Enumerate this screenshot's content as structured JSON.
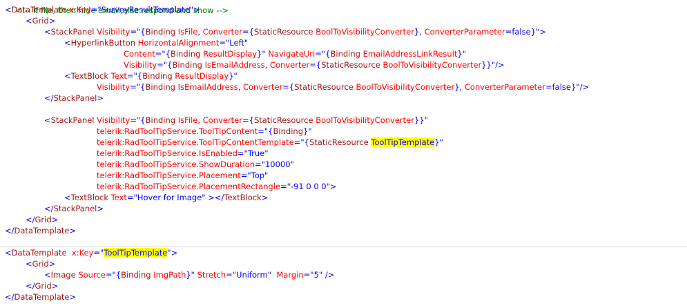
{
  "code": {
    "comment_fragment": "<!-- If file, then hide email,else respond and show -->",
    "lines": [
      {
        "indent": 0,
        "tokens": [
          [
            "p",
            "<"
          ],
          [
            "k",
            "DataTemplate"
          ],
          [
            "a",
            " x:Key"
          ],
          [
            "v",
            "=\"SurveyResultTemplate\""
          ],
          [
            "p",
            ">"
          ]
        ]
      },
      {
        "indent": 1,
        "tokens": [
          [
            "p",
            "<"
          ],
          [
            "k",
            "Grid"
          ],
          [
            "p",
            ">"
          ]
        ]
      },
      {
        "indent": 2,
        "tokens": [
          [
            "p",
            "<"
          ],
          [
            "k",
            "StackPanel"
          ],
          [
            "a",
            " Visibility"
          ],
          [
            "v",
            "=\"{"
          ],
          [
            "k",
            "Binding"
          ],
          [
            "a",
            " IsFile"
          ],
          [
            "v",
            ", "
          ],
          [
            "a",
            "Converter"
          ],
          [
            "v",
            "={"
          ],
          [
            "k",
            "StaticResource"
          ],
          [
            "a",
            " BoolToVisibilityConverter"
          ],
          [
            "v",
            "}, "
          ],
          [
            "a",
            "ConverterParameter"
          ],
          [
            "v",
            "=false}\""
          ],
          [
            "p",
            ">"
          ]
        ]
      },
      {
        "indent": 3,
        "tokens": [
          [
            "p",
            "<"
          ],
          [
            "k",
            "HyperlinkButton"
          ],
          [
            "a",
            " HorizontalAlignment"
          ],
          [
            "v",
            "=\"Left\""
          ]
        ]
      },
      {
        "indent": 5,
        "tokens": [
          [
            "a",
            "Content"
          ],
          [
            "v",
            "=\"{"
          ],
          [
            "k",
            "Binding"
          ],
          [
            "a",
            " ResultDisplay"
          ],
          [
            "v",
            "}\" "
          ],
          [
            "a",
            "NavigateUri"
          ],
          [
            "v",
            "=\"{"
          ],
          [
            "k",
            "Binding"
          ],
          [
            "a",
            " EmailAddressLinkResult"
          ],
          [
            "v",
            "}\""
          ]
        ]
      },
      {
        "indent": 5,
        "tokens": [
          [
            "a",
            "Visibility"
          ],
          [
            "v",
            "=\"{"
          ],
          [
            "k",
            "Binding"
          ],
          [
            "a",
            " IsEmailAddress"
          ],
          [
            "v",
            ", "
          ],
          [
            "a",
            "Converter"
          ],
          [
            "v",
            "={"
          ],
          [
            "k",
            "StaticResource"
          ],
          [
            "a",
            " BoolToVisibilityConverter"
          ],
          [
            "v",
            "}}\""
          ],
          [
            "p",
            "/>"
          ]
        ]
      },
      {
        "indent": 3,
        "tokens": [
          [
            "p",
            "<"
          ],
          [
            "k",
            "TextBlock"
          ],
          [
            "a",
            " Text"
          ],
          [
            "v",
            "=\"{"
          ],
          [
            "k",
            "Binding"
          ],
          [
            "a",
            " ResultDisplay"
          ],
          [
            "v",
            "}\""
          ]
        ]
      },
      {
        "indent": 4,
        "tokens": [
          [
            "a",
            "Visibility"
          ],
          [
            "v",
            "=\"{"
          ],
          [
            "k",
            "Binding"
          ],
          [
            "a",
            " IsEmailAddress"
          ],
          [
            "v",
            ", "
          ],
          [
            "a",
            "Converter"
          ],
          [
            "v",
            "={"
          ],
          [
            "k",
            "StaticResource"
          ],
          [
            "a",
            " BoolToVisibilityConverter"
          ],
          [
            "v",
            "}, "
          ],
          [
            "a",
            "ConverterParameter"
          ],
          [
            "v",
            "=false}\""
          ],
          [
            "p",
            "/>"
          ]
        ]
      },
      {
        "indent": 2,
        "tokens": [
          [
            "p",
            "</"
          ],
          [
            "k",
            "StackPanel"
          ],
          [
            "p",
            ">"
          ]
        ]
      },
      {
        "indent": 0,
        "tokens": []
      },
      {
        "indent": 2,
        "tokens": [
          [
            "p",
            "<"
          ],
          [
            "k",
            "StackPanel"
          ],
          [
            "a",
            " Visibility"
          ],
          [
            "v",
            "=\"{"
          ],
          [
            "k",
            "Binding"
          ],
          [
            "a",
            " IsFile"
          ],
          [
            "v",
            ", "
          ],
          [
            "a",
            "Converter"
          ],
          [
            "v",
            "={"
          ],
          [
            "k",
            "StaticResource"
          ],
          [
            "a",
            " BoolToVisibilityConverter"
          ],
          [
            "v",
            "}}\""
          ]
        ]
      },
      {
        "indent": 4,
        "tokens": [
          [
            "a",
            "telerik:RadToolTipService.ToolTipContent"
          ],
          [
            "v",
            "=\"{"
          ],
          [
            "k",
            "Binding"
          ],
          [
            "v",
            "}\""
          ]
        ]
      },
      {
        "indent": 4,
        "tokens": [
          [
            "a",
            "telerik:RadToolTipService.ToolTipContentTemplate"
          ],
          [
            "v",
            "=\"{"
          ],
          [
            "k",
            "StaticResource"
          ],
          [
            "v",
            " "
          ],
          [
            "h",
            "ToolTipTemplate"
          ],
          [
            "v",
            "}\""
          ]
        ]
      },
      {
        "indent": 4,
        "tokens": [
          [
            "a",
            "telerik:RadToolTipService.IsEnabled"
          ],
          [
            "v",
            "=\"True\""
          ]
        ]
      },
      {
        "indent": 4,
        "tokens": [
          [
            "a",
            "telerik:RadToolTipService.ShowDuration"
          ],
          [
            "v",
            "=\"10000\""
          ]
        ]
      },
      {
        "indent": 4,
        "tokens": [
          [
            "a",
            "telerik:RadToolTipService.Placement"
          ],
          [
            "v",
            "=\"Top\""
          ]
        ]
      },
      {
        "indent": 4,
        "tokens": [
          [
            "a",
            "telerik:RadToolTipService.PlacementRectangle"
          ],
          [
            "v",
            "=\"-91 0 0 0\""
          ],
          [
            "p",
            ">"
          ]
        ]
      },
      {
        "indent": 3,
        "tokens": [
          [
            "p",
            "<"
          ],
          [
            "k",
            "TextBlock"
          ],
          [
            "a",
            " Text"
          ],
          [
            "v",
            "=\"Hover for Image\" "
          ],
          [
            "p",
            "></"
          ],
          [
            "k",
            "TextBlock"
          ],
          [
            "p",
            ">"
          ]
        ]
      },
      {
        "indent": 2,
        "tokens": [
          [
            "p",
            "</"
          ],
          [
            "k",
            "StackPanel"
          ],
          [
            "p",
            ">"
          ]
        ]
      },
      {
        "indent": 1,
        "tokens": [
          [
            "p",
            "</"
          ],
          [
            "k",
            "Grid"
          ],
          [
            "p",
            ">"
          ]
        ]
      },
      {
        "indent": 0,
        "tokens": [
          [
            "p",
            "</"
          ],
          [
            "k",
            "DataTemplate"
          ],
          [
            "p",
            ">"
          ]
        ]
      },
      {
        "indent": 0,
        "tokens": []
      },
      {
        "indent": 0,
        "tokens": [
          [
            "p",
            "<"
          ],
          [
            "k",
            "DataTemplate"
          ],
          [
            "a",
            "  x:Key"
          ],
          [
            "v",
            "=\""
          ],
          [
            "h",
            "ToolTipTemplate"
          ],
          [
            "v",
            "\""
          ],
          [
            "p",
            ">"
          ]
        ]
      },
      {
        "indent": 1,
        "tokens": [
          [
            "p",
            "<"
          ],
          [
            "k",
            "Grid"
          ],
          [
            "p",
            ">"
          ]
        ]
      },
      {
        "indent": 2,
        "tokens": [
          [
            "p",
            "<"
          ],
          [
            "k",
            "Image"
          ],
          [
            "a",
            " Source"
          ],
          [
            "v",
            "=\"{"
          ],
          [
            "k",
            "Binding"
          ],
          [
            "a",
            " ImgPath"
          ],
          [
            "v",
            "}\" "
          ],
          [
            "a",
            "Stretch"
          ],
          [
            "v",
            "=\"Uniform\"  "
          ],
          [
            "a",
            "Margin"
          ],
          [
            "v",
            "=\"5\" "
          ],
          [
            "p",
            "/>"
          ]
        ]
      },
      {
        "indent": 1,
        "tokens": [
          [
            "p",
            "</"
          ],
          [
            "k",
            "Grid"
          ],
          [
            "p",
            ">"
          ]
        ]
      },
      {
        "indent": 0,
        "tokens": [
          [
            "p",
            "</"
          ],
          [
            "k",
            "DataTemplate"
          ],
          [
            "p",
            ">"
          ]
        ]
      }
    ]
  }
}
